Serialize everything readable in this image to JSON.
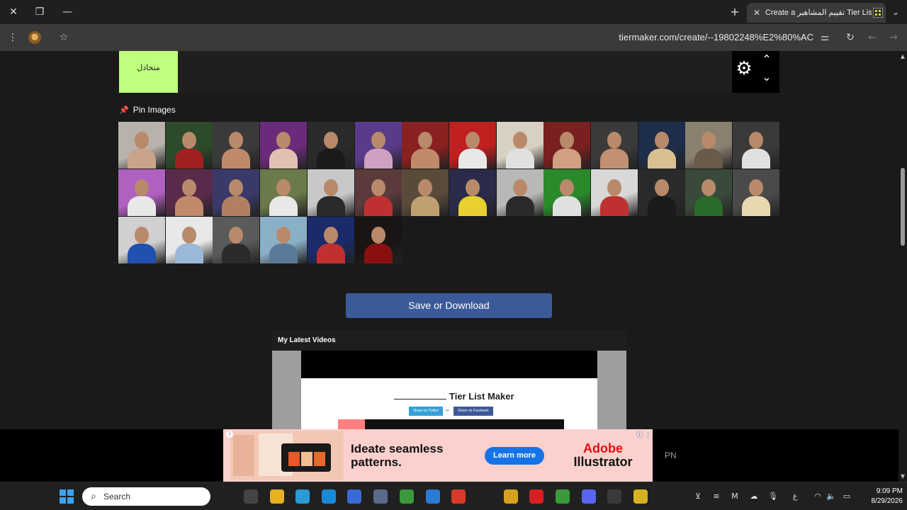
{
  "browser": {
    "tab_title": "Create a تقييم المشاهير Tier List",
    "url": "tiermaker.com/create/--19802248%E2%80%AC",
    "icons": [
      "close-icon",
      "restore-icon",
      "minimize-icon",
      "new-tab-icon",
      "tab-menu-icon",
      "kebab-menu-icon",
      "bookmark-star-icon",
      "tune-icon",
      "reload-icon",
      "back-icon",
      "forward-icon"
    ]
  },
  "tier": {
    "label": "متخاذل",
    "color": "#bfff7f"
  },
  "pin_images": {
    "label": "Pin Images",
    "pin_glyph": "📌"
  },
  "images": [
    [
      "#b8b2aa",
      "#c9a38a"
    ],
    [
      "#2d4a2a",
      "#a02020"
    ],
    [
      "#3a3a3a",
      "#c08a6a"
    ],
    [
      "#6a2b7a",
      "#e0c0b0"
    ],
    [
      "#2a2a2a",
      "#1a1a1a"
    ],
    [
      "#5a3a8a",
      "#d0a0c0"
    ],
    [
      "#8a2020",
      "#c08a6a"
    ],
    [
      "#c02020",
      "#e8e8e8"
    ],
    [
      "#d8d0c0",
      "#e0e0e0"
    ],
    [
      "#7a2020",
      "#d0a080"
    ],
    [
      "#3a3a3a",
      "#c09070"
    ],
    [
      "#1e2e4a",
      "#d8c090"
    ],
    [
      "#8a8070",
      "#6a5a4a"
    ],
    [
      "#3a3a3a",
      "#e0e0e0"
    ],
    [
      "#b060c0",
      "#e8e8e8"
    ],
    [
      "#5a2a4a",
      "#c08a6a"
    ],
    [
      "#3a3a6a",
      "#b08060"
    ],
    [
      "#6a7a4a",
      "#e8e8e8"
    ],
    [
      "#c8c8c8",
      "#2a2a2a"
    ],
    [
      "#5a3a3a",
      "#c03030"
    ],
    [
      "#5a4a3a",
      "#c0a070"
    ],
    [
      "#2a2a4a",
      "#e8d030"
    ],
    [
      "#b8b8b8",
      "#2a2a2a"
    ],
    [
      "#2a8a2a",
      "#e0e0e0"
    ],
    [
      "#d8d8d8",
      "#c03030"
    ],
    [
      "#2a2a2a",
      "#1a1a1a"
    ],
    [
      "#3a4a3a",
      "#2a6a2a"
    ],
    [
      "#4a4a4a",
      "#e8d8b0"
    ],
    [
      "#d0d0d0",
      "#2050b0"
    ],
    [
      "#e8e8e8",
      "#9ab8d8"
    ],
    [
      "#5a5a5a",
      "#2a2a2a"
    ],
    [
      "#8ab0c8",
      "#5a7a9a"
    ],
    [
      "#1a2a6a",
      "#c03030"
    ],
    [
      "#1a1414",
      "#8a1010"
    ]
  ],
  "save_button": "Save or Download",
  "videos": {
    "title": "My Latest Videos",
    "video_title": "Tier List Maker",
    "share_twitter": "Share on Twitter",
    "or": "or",
    "share_facebook": "Share on Facebook"
  },
  "ad": {
    "headline": "Ideate seamless patterns.",
    "cta": "Learn more",
    "brand_line1": "Adobe",
    "brand_line2": "Illustrator",
    "side_text": "PN",
    "corner_icons": "ⓘ ⋮"
  },
  "taskbar": {
    "search_placeholder": "Search",
    "time": "9:09 PM",
    "date": "8/29/2026",
    "apps": [
      {
        "name": "task-view-icon",
        "color": "#444"
      },
      {
        "name": "file-explorer-icon",
        "color": "#e8b020"
      },
      {
        "name": "telegram-icon",
        "color": "#2a9ad8"
      },
      {
        "name": "edge-icon",
        "color": "#1a8ad8"
      },
      {
        "name": "store-icon",
        "color": "#3a6ad8"
      },
      {
        "name": "mail-icon",
        "color": "#5a6a8a"
      },
      {
        "name": "chrome-icon",
        "color": "#3a9a3a"
      },
      {
        "name": "app-icon",
        "color": "#2a7ad8"
      },
      {
        "name": "pdf-icon",
        "color": "#d83a2a"
      },
      {
        "name": "netflix-icon",
        "color": "#202020"
      },
      {
        "name": "chrome-beta-icon",
        "color": "#d8a020"
      },
      {
        "name": "wps-icon",
        "color": "#d82020"
      },
      {
        "name": "chrome-active-icon",
        "color": "#3a9a3a"
      },
      {
        "name": "discord-icon",
        "color": "#5865f2"
      },
      {
        "name": "chatgpt-icon",
        "color": "#3a3a3a"
      },
      {
        "name": "warning-icon",
        "color": "#d8b020"
      }
    ]
  }
}
